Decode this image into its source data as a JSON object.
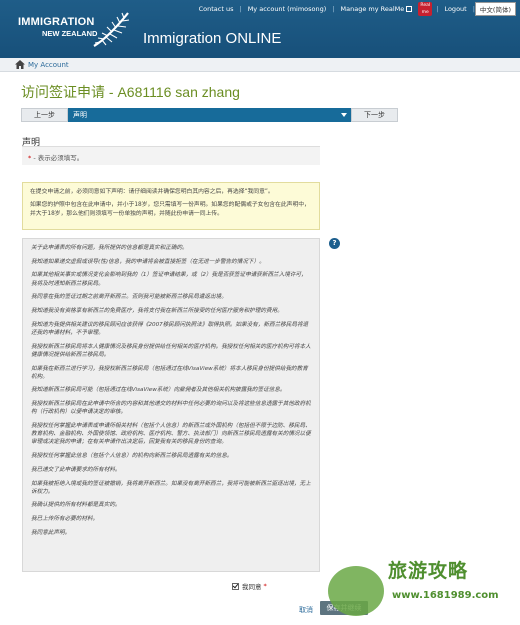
{
  "header": {
    "brand_top": "IMMIGRATION",
    "brand_bottom": "NEW ZEALAND",
    "app_title": "Immigration ONLINE",
    "nav": {
      "contact": "Contact us",
      "account": "My account (mimosong)",
      "realme": "Manage my RealMe",
      "logout": "Logout",
      "language": "中文(简体)"
    }
  },
  "breadcrumb": {
    "item": "My Account"
  },
  "page": {
    "title": "访问签证申请 - A681116 san zhang"
  },
  "stepnav": {
    "prev": "上一步",
    "current": "声明",
    "next": "下一步"
  },
  "section": {
    "title": "声明",
    "required_star": "*",
    "required_text": " - 表示必须填写。"
  },
  "notice": {
    "p1": "在提交申请之前，必须同意如下声明：请仔细阅读并确保您明白其内容之后，再选择“我同意”。",
    "p2": "如果您的护照中包含在此申请中，并小于18岁，您只需填写一份声明。如果您的配偶或子女包含在此声明中，并大于18岁，那么他们则须填写一份单独的声明，并随此份申请一同上传。"
  },
  "declaration": [
    "关于此申请表的所有问题，我所提供的信息都是真实和正确的。",
    "我知道如果递交虚假或误导(性)信息，我的申请将会被直接拒签（在无进一步警告的情况下）。",
    "如果其他相关事实或情况变化会影响到我的（1）签证申请结果，或（2）我是否获签证申请获新西兰入境许可，我将及时通知新西兰移民局。",
    "我同意在我的签证过期之前离开新西兰。否则我可能被新西兰移民局遣返出境。",
    "我知道我没有资格享有新西兰的免费医疗，我将支付我在新西兰所接受的任何医疗服务和护理的费用。",
    "我知道为我提供相关建议的移民顾问应该获得《2007移民顾问执照法》取得执照。如果没有，新西兰移民局将退还我的申请材料，不予审理。",
    "我授权新西兰移民局将本人健康情况及移民身份提供给任何相关的医疗机构。我授权任何相关的医疗机构可将本人健康情况提供给新西兰移民局。",
    "如果我在新西兰进行学习，我授权新西兰移民局（包括通过在线VisaView系统）将本人移民身份提供给我的教育机构。",
    "我知道新西兰移民局可能（包括通过在线VisaView系统）向雇佣者及其他相关机构披露我的签证信息。",
    "我授权新西兰移民局在此申请中所含的内容和其他递交的材料中任何必要的询问以及将这些信息透露于其他政府机构（行政机构）以便申请决定的审核。",
    "我授权任何掌握此申请表或申请所相关材料（包括个人信息）的新西兰或外国机构（包括但不限于边防、移民局、教育机构、金融机构、外国使领馆、政府机构、医疗机构、警方、执法部门）向新西兰移民局透露有关的情况以便审理或决定我的申请；在有关申请作出决定后，回复我有关的移民身份的查询。",
    "我授权任何掌握此信息（包括个人信息）的机构向新西兰移民局透露有关的信息。",
    "我已递交了此申请要求的所有材料。",
    "如果我被拒绝入境或我的签证被撤销，我将离开新西兰。如果没有离开新西兰，我将可能被新西兰驱逐出境，无上诉权力。",
    "我确认提供的所有材料都是真实的。",
    "我已上传所有必要的材料。",
    "我同意此声明。"
  ],
  "agree": {
    "label": "我同意",
    "star": "*"
  },
  "actions": {
    "cancel": "取消",
    "save": "保存并继续"
  },
  "watermark": {
    "text": "旅游攻略",
    "url": "www.1681989.com"
  },
  "colors": {
    "header_bg": "#1a5580",
    "title_green": "#6b8e23",
    "step_blue": "#176b9a",
    "notice_bg": "#fdfbd7"
  }
}
